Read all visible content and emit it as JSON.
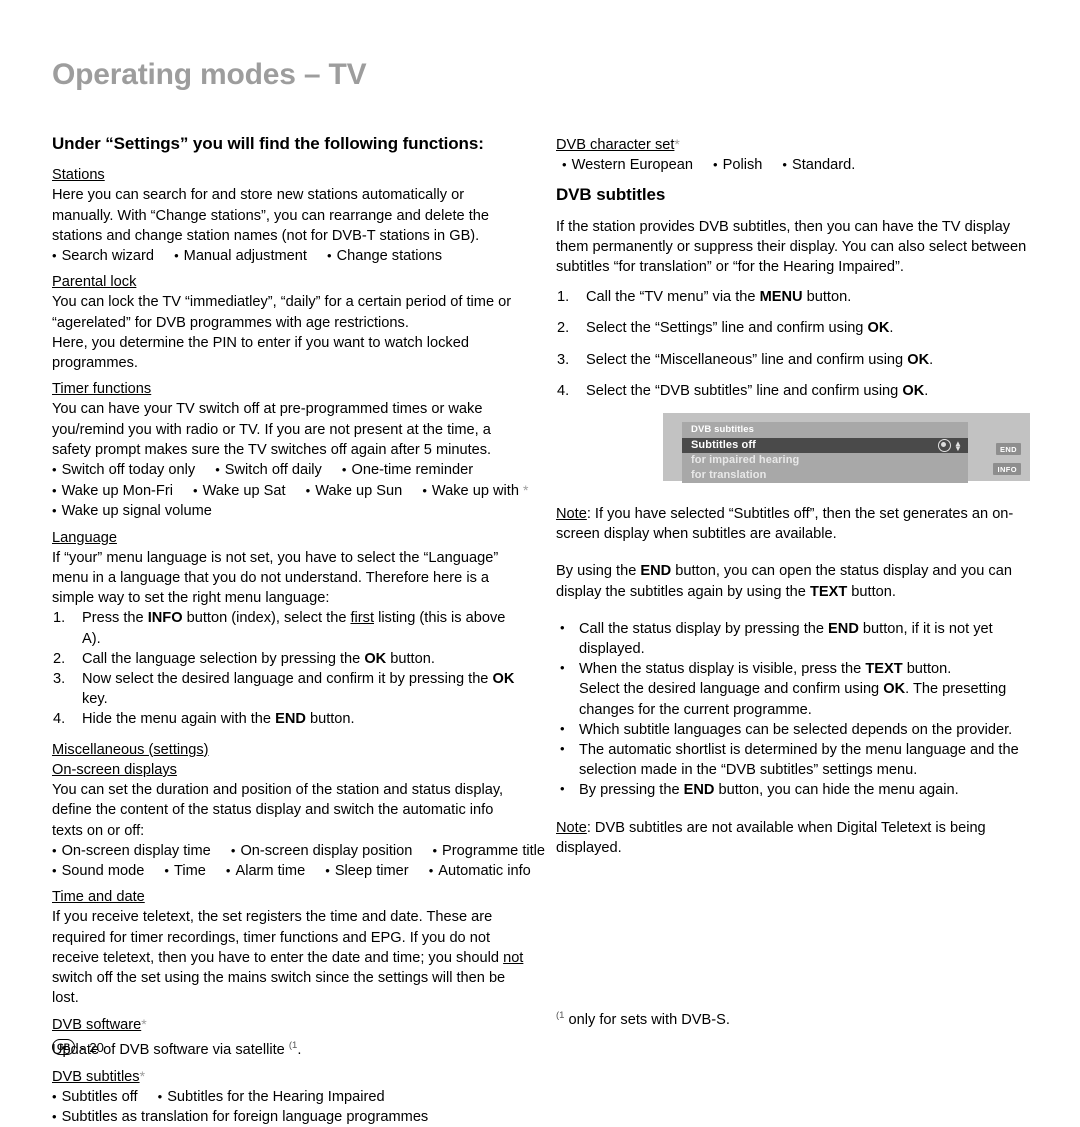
{
  "page": {
    "title": "Operating modes – TV",
    "footer": {
      "locale_badge": "GB",
      "separator": "-",
      "page_number": "20"
    },
    "footnote": {
      "marker": "(1",
      "text": "only for sets with DVB-S."
    }
  },
  "left_column": {
    "heading": "Under “Settings” you will find the following functions:",
    "sections": [
      {
        "head": "Stations",
        "paragraph": "Here you can search for and store new stations automatically or manually. With “Change stations”, you can rearrange and delete the stations and change station names (not for DVB-T stations in GB).",
        "bullets": [
          "Search wizard",
          "Manual adjustment",
          "Change stations"
        ]
      },
      {
        "head": "Parental lock",
        "paragraph": "You can lock the TV “immediatley”, “daily” for a certain period of time or “agerelated” for DVB programmes with age restrictions.",
        "paragraph2": "Here, you determine the PIN to enter if you want to watch locked programmes."
      },
      {
        "head": "Timer functions",
        "paragraph": "You can have your TV switch off at pre-programmed times or wake you/remind you with radio or TV. If you are not present at the time, a safety prompt makes sure the TV switches off again after 5 minutes.",
        "bullets_line1": [
          "Switch off today only",
          "Switch off daily",
          "One-time reminder"
        ],
        "bullets_line2": [
          "Wake up Mon-Fri",
          "Wake up Sat",
          "Wake up Sun",
          "Wake up with"
        ],
        "bullets_line3": [
          "Wake up signal volume"
        ]
      },
      {
        "head": "Language",
        "paragraph": "If “your” menu language is not set, you have to select the “Language” menu in a language that you do not understand. Therefore here is a simple way to set the right menu language:",
        "steps": [
          {
            "n": "1.",
            "pre": "Press the ",
            "key": "INFO",
            "mid": " button (index), select the ",
            "ul": "first",
            "post": " listing (this is above A)."
          },
          {
            "n": "2.",
            "pre": "Call the language selection by pressing the ",
            "key": "OK",
            "mid": "",
            "ul": "",
            "post": " button."
          },
          {
            "n": "3.",
            "pre": "Now select the desired language and confirm it by pressing the ",
            "key": "OK",
            "mid": "",
            "ul": "",
            "post": " key."
          },
          {
            "n": "4.",
            "pre": "Hide the menu again with the ",
            "key": "END",
            "mid": "",
            "ul": "",
            "post": " button."
          }
        ]
      },
      {
        "head": "Miscellaneous (settings)",
        "head2": "On-screen displays",
        "paragraph": "You can set the duration and position of the station and status display, define the content of the status display and switch the automatic info texts on or off:",
        "bullets_line1": [
          "On-screen display time",
          "On-screen display position",
          "Programme title"
        ],
        "bullets_line2": [
          "Sound mode",
          "Time",
          "Alarm time",
          "Sleep timer",
          "Automatic info"
        ]
      },
      {
        "head": "Time and date",
        "paragraph_a": "If you receive teletext, the set registers the time and date. These are required for timer recordings, timer functions and EPG. If you do not receive teletext, then you have to enter the date and time; you should ",
        "paragraph_ul": "not",
        "paragraph_b": " switch off the set using the mains switch since the settings will then be lost."
      },
      {
        "head": "DVB software",
        "star": "*",
        "paragraph_a": "Update of DVB software via satellite ",
        "paragraph_sup": "(1",
        "paragraph_b": "."
      },
      {
        "head": "DVB subtitles",
        "star": "*",
        "bullets_line1": [
          "Subtitles off",
          "Subtitles for the Hearing Impaired"
        ],
        "bullets_line2": [
          "Subtitles as translation for foreign language programmes"
        ]
      }
    ]
  },
  "right_column": {
    "charset": {
      "head": "DVB character set",
      "star": "*",
      "bullets": [
        "Western European",
        "Polish",
        "Standard."
      ]
    },
    "subtitles": {
      "heading": "DVB subtitles",
      "intro": "If the station provides DVB subtitles, then you can have the TV display them permanently or suppress their display. You can also select between subtitles “for translation” or “for the Hearing Impaired”.",
      "steps": [
        {
          "n": "1.",
          "pre": "Call the “TV menu” via the ",
          "key": "MENU",
          "post": " button."
        },
        {
          "n": "2.",
          "pre": "Select the “Settings” line and confirm using ",
          "key": "OK",
          "post": "."
        },
        {
          "n": "3.",
          "pre": "Select the “Miscellaneous” line and confirm using ",
          "key": "OK",
          "post": "."
        },
        {
          "n": "4.",
          "pre": "Select the “DVB subtitles” line and confirm using ",
          "key": "OK",
          "post": "."
        }
      ]
    },
    "tv_screenshot": {
      "menu_title": "DVB subtitles",
      "rows": [
        {
          "label": "Subtitles off",
          "selected": true
        },
        {
          "label": "for impaired hearing",
          "selected": false
        },
        {
          "label": "for translation",
          "selected": false
        }
      ],
      "keys": [
        "END",
        "INFO"
      ]
    },
    "note1_label": "Note",
    "note1_text": ": If you have selected “Subtitles off”, then the set generates an on-screen display when subtitles are available.",
    "end_text": {
      "a": "By using the ",
      "key1": "END",
      "b": " button, you can open the status display and you can display the subtitles again by using the ",
      "key2": "TEXT",
      "c": " button."
    },
    "bullets": [
      {
        "a": "Call the status display by pressing the ",
        "key": "END",
        "b": " button, if it is not yet displayed."
      },
      {
        "a": "When the status display is visible, press the ",
        "key": "TEXT",
        "b": " button."
      },
      {
        "a": "Select the desired language and confirm using ",
        "key": "OK",
        "b": ". The presetting changes for the current programme.",
        "continuation": true
      },
      {
        "a": "Which subtitle languages can be selected depends on the provider.",
        "key": "",
        "b": ""
      },
      {
        "a": "The automatic shortlist is determined by the menu language and the selection made in the “DVB subtitles” settings menu.",
        "key": "",
        "b": ""
      },
      {
        "a": "By pressing the ",
        "key": "END",
        "b": " button, you can hide the menu again."
      }
    ],
    "note2_label": "Note",
    "note2_text": ": DVB subtitles are not available when Digital Teletext is being displayed."
  }
}
